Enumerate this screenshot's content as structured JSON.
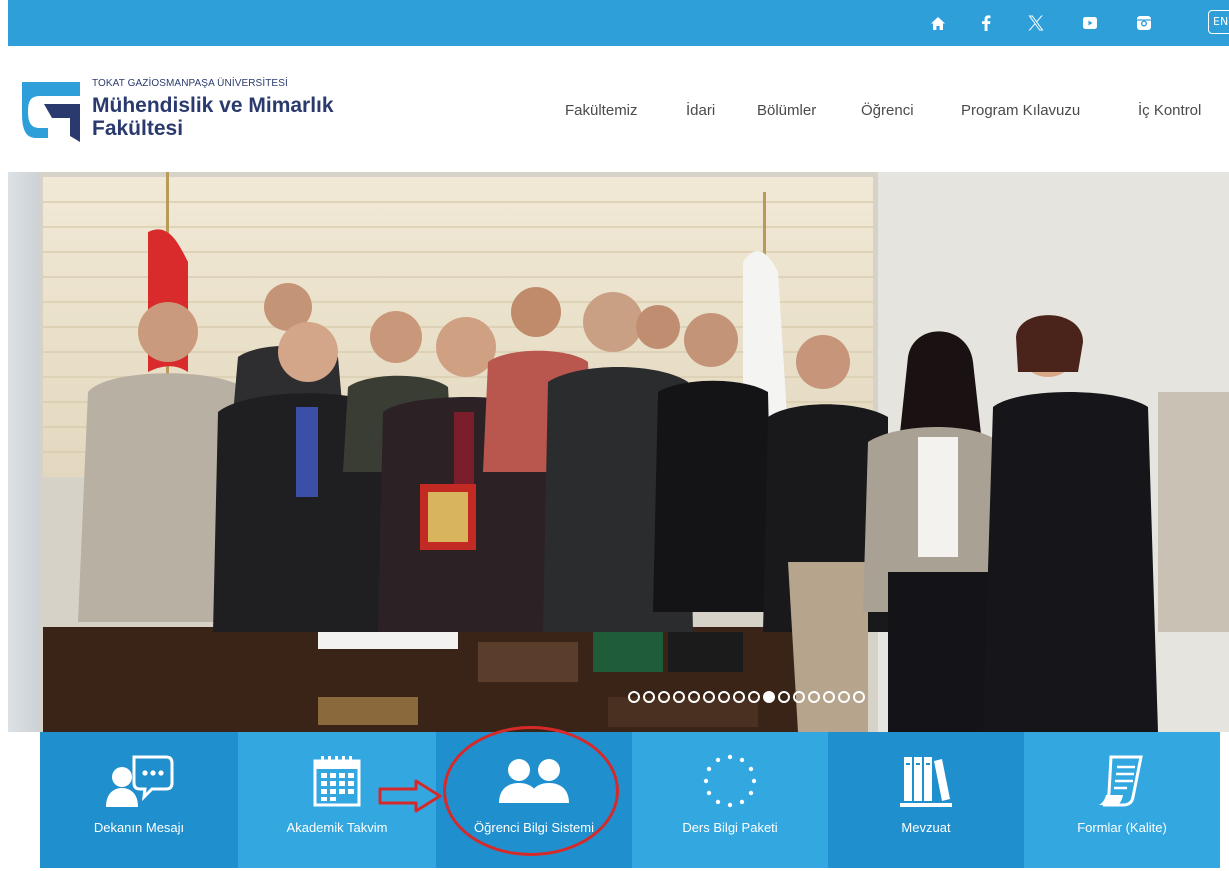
{
  "topbar": {
    "icons": [
      "home-icon",
      "facebook-icon",
      "x-twitter-icon",
      "youtube-icon",
      "instagram-icon"
    ],
    "lang": "EN"
  },
  "header": {
    "university": "TOKAT GAZİOSMANPAŞA ÜNİVERSİTESİ",
    "faculty": "Mühendislik ve Mimarlık Fakültesi",
    "nav": [
      "Fakültemiz",
      "İdari",
      "Bölümler",
      "Öğrenci",
      "Program Kılavuzu",
      "İç Kontrol"
    ]
  },
  "slider": {
    "total": 16,
    "active": 10
  },
  "quicklinks": [
    {
      "label": "Dekanın Mesajı",
      "icon": "speech-bubble-person-icon"
    },
    {
      "label": "Akademik Takvim",
      "icon": "calendar-icon"
    },
    {
      "label": "Öğrenci Bilgi Sistemi",
      "icon": "two-users-icon"
    },
    {
      "label": "Ders Bilgi Paketi",
      "icon": "eu-stars-icon"
    },
    {
      "label": "Mevzuat",
      "icon": "books-icon"
    },
    {
      "label": "Formlar (Kalite)",
      "icon": "document-icon"
    }
  ],
  "colors": {
    "brand_blue": "#2e9fd9",
    "tile_dark": "#1f8fcd",
    "tile_light": "#33a7e0",
    "navy": "#2b3a6e",
    "annotation_red": "#d62a2a"
  }
}
